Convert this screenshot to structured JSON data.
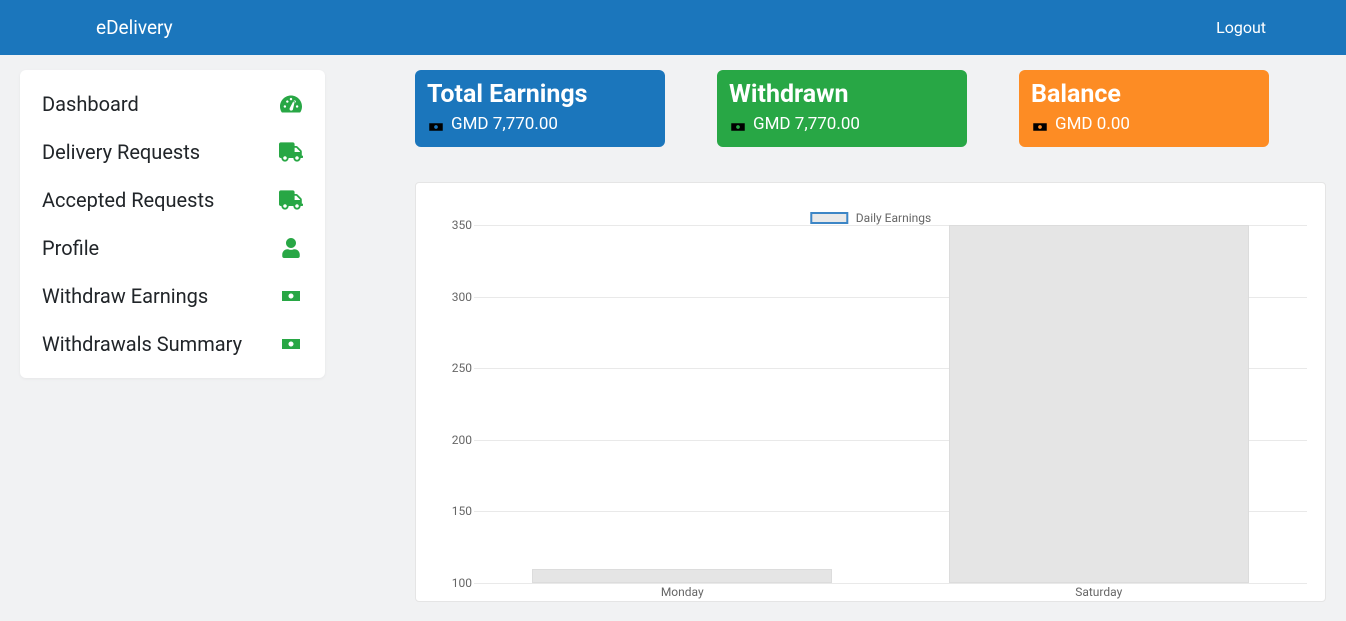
{
  "brand": "eDelivery",
  "logout": "Logout",
  "sidebar": {
    "items": [
      {
        "label": "Dashboard",
        "icon": "tachometer"
      },
      {
        "label": "Delivery Requests",
        "icon": "truck"
      },
      {
        "label": "Accepted Requests",
        "icon": "truck"
      },
      {
        "label": "Profile",
        "icon": "user"
      },
      {
        "label": "Withdraw Earnings",
        "icon": "money"
      },
      {
        "label": "Withdrawals Summary",
        "icon": "money"
      }
    ]
  },
  "cards": {
    "total_earnings": {
      "title": "Total Earnings",
      "value": "GMD 7,770.00"
    },
    "withdrawn": {
      "title": "Withdrawn",
      "value": "GMD 7,770.00"
    },
    "balance": {
      "title": "Balance",
      "value": "GMD 0.00"
    }
  },
  "chart": {
    "legend": "Daily Earnings"
  },
  "chart_data": {
    "type": "bar",
    "title": "",
    "xlabel": "",
    "ylabel": "",
    "ylim": [
      100,
      350
    ],
    "yticks": [
      350,
      300,
      250,
      200,
      150,
      100
    ],
    "categories": [
      "Monday",
      "Saturday"
    ],
    "series": [
      {
        "name": "Daily Earnings",
        "values": [
          110,
          350
        ]
      }
    ]
  }
}
